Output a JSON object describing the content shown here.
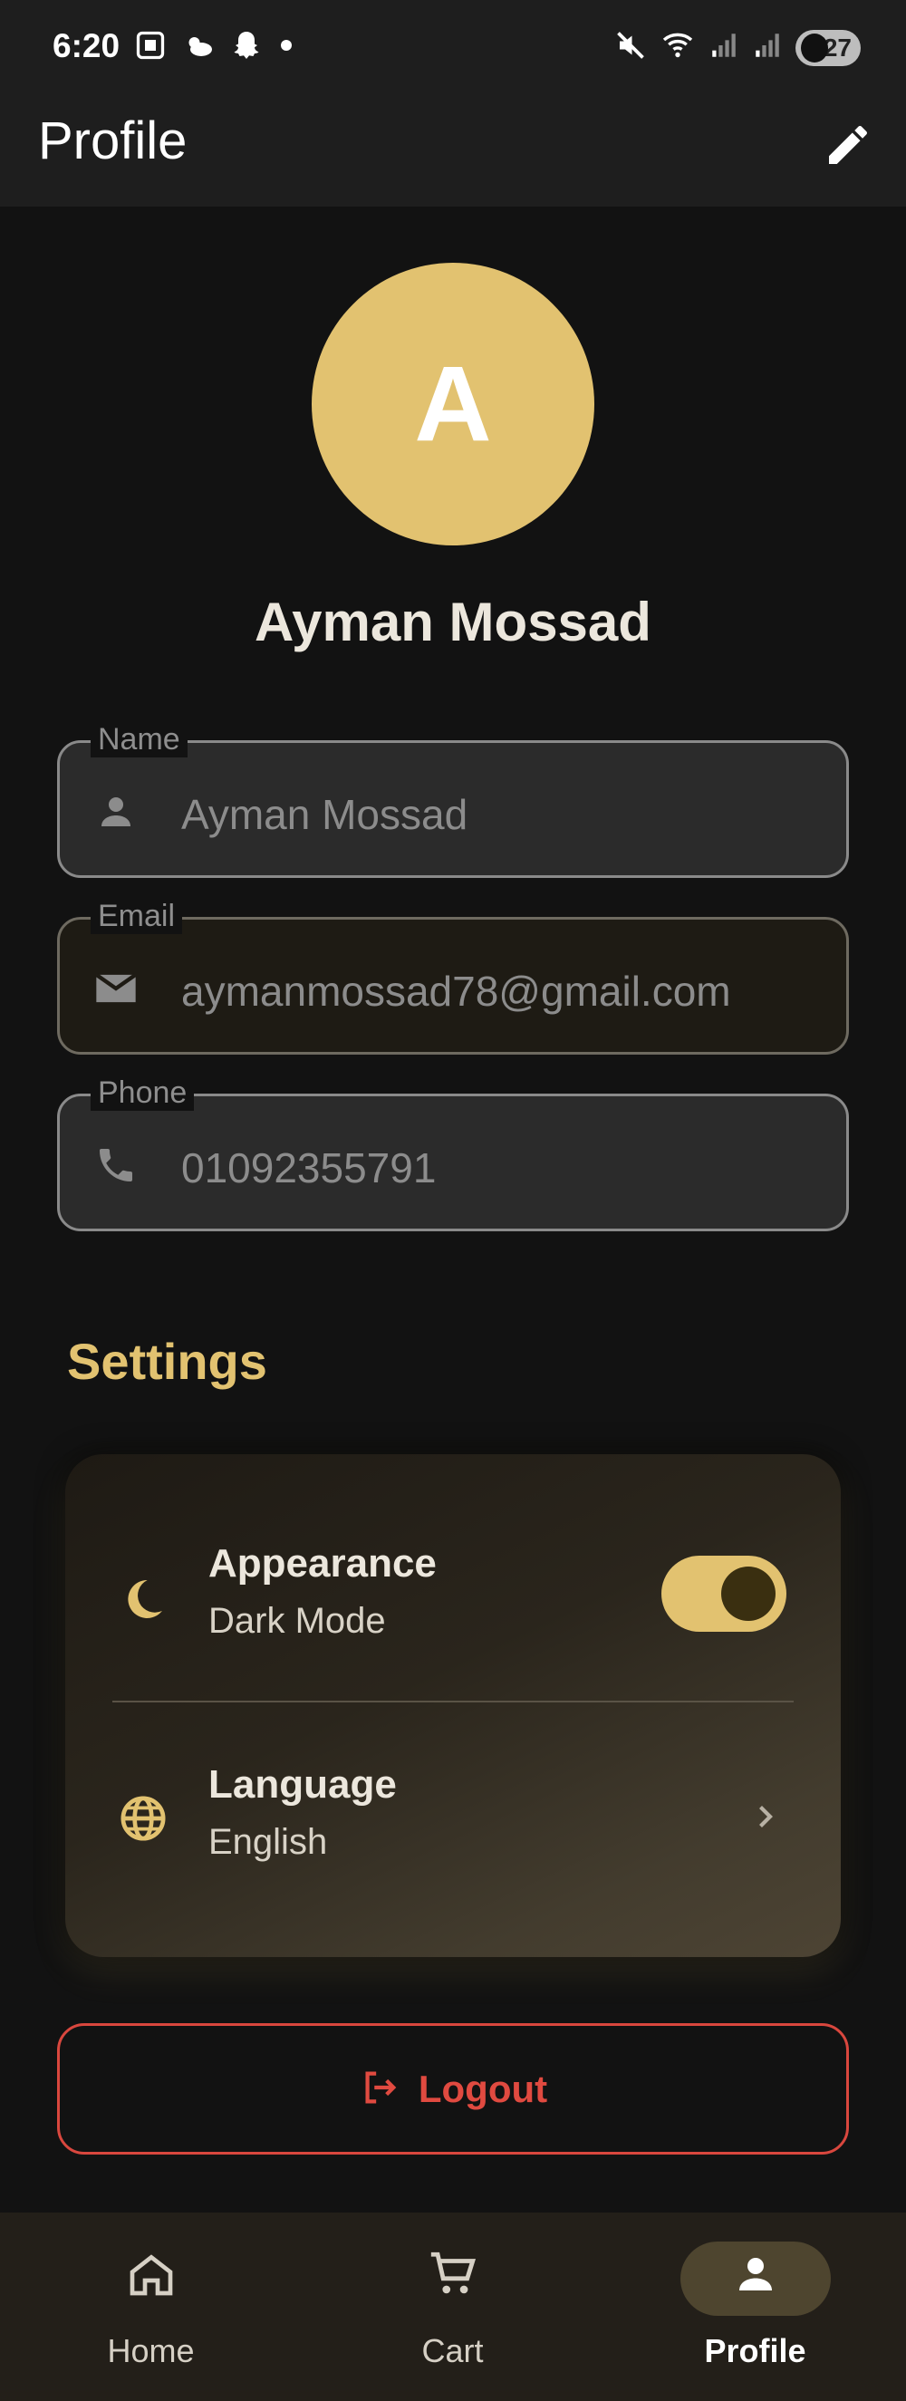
{
  "status_bar": {
    "time": "6:20",
    "battery_level": "27"
  },
  "app_bar": {
    "title": "Profile"
  },
  "profile": {
    "avatar_initial": "A",
    "display_name": "Ayman Mossad"
  },
  "fields": {
    "name": {
      "label": "Name",
      "value": "Ayman Mossad"
    },
    "email": {
      "label": "Email",
      "value": "aymanmossad78@gmail.com"
    },
    "phone": {
      "label": "Phone",
      "value": "01092355791"
    }
  },
  "settings": {
    "title": "Settings",
    "appearance": {
      "title": "Appearance",
      "subtitle": "Dark Mode",
      "enabled": true
    },
    "language": {
      "title": "Language",
      "subtitle": "English"
    }
  },
  "logout": {
    "label": "Logout"
  },
  "bottom_nav": {
    "items": [
      {
        "label": "Home",
        "icon": "home-icon",
        "active": false
      },
      {
        "label": "Cart",
        "icon": "cart-icon",
        "active": false
      },
      {
        "label": "Profile",
        "icon": "person-icon",
        "active": true
      }
    ]
  },
  "colors": {
    "accent": "#E2C270",
    "danger": "#E04A40",
    "background": "#121212",
    "surface": "#1E1E1E"
  }
}
